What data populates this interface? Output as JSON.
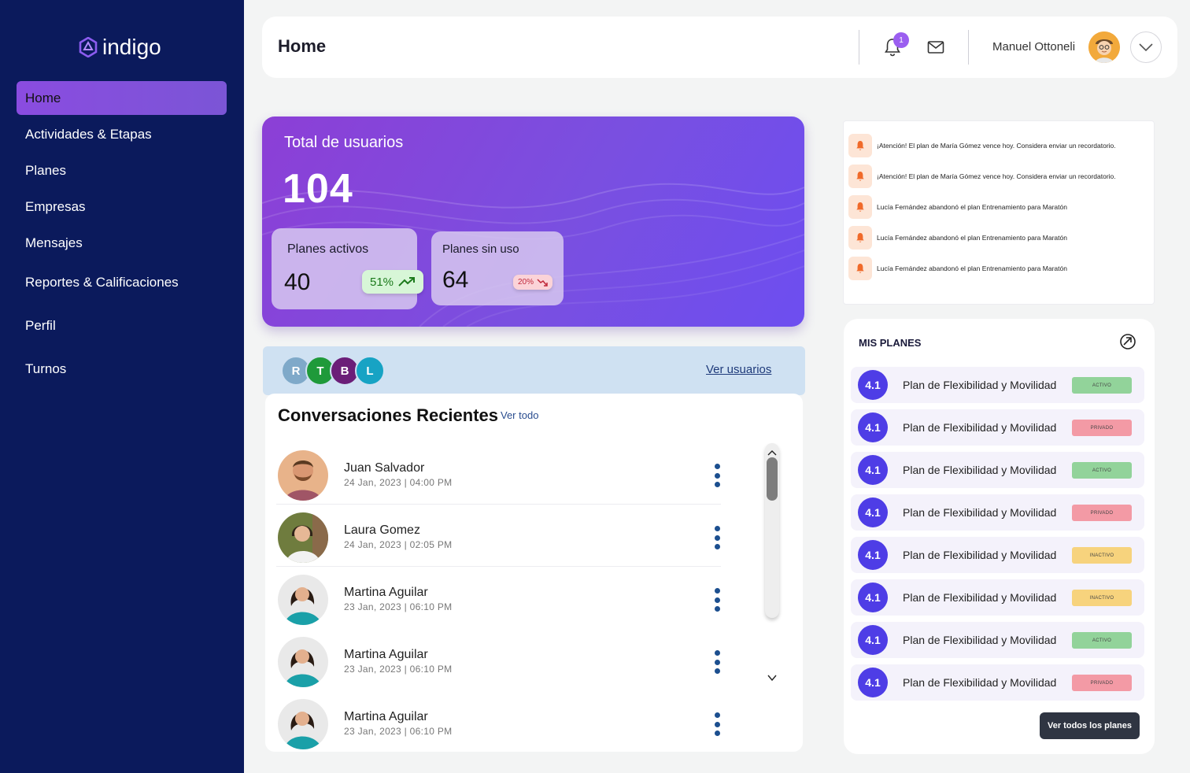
{
  "app": {
    "name": "indigo"
  },
  "sidebar": {
    "items": [
      {
        "label": "Home",
        "active": true
      },
      {
        "label": "Actividades & Etapas"
      },
      {
        "label": "Planes"
      },
      {
        "label": "Empresas"
      },
      {
        "label": "Mensajes"
      },
      {
        "label": "Reportes & Calificaciones"
      },
      {
        "label": "Perfil"
      },
      {
        "label": "Turnos"
      }
    ]
  },
  "header": {
    "title": "Home",
    "notification_count": "1",
    "user_name": "Manuel Ottoneli",
    "icons": [
      "bell-icon",
      "mail-icon",
      "chevron-down-icon"
    ]
  },
  "summary": {
    "label": "Total de usuarios",
    "value": "104",
    "active": {
      "label": "Planes activos",
      "value": "40",
      "change": "51%",
      "trend": "up"
    },
    "unused": {
      "label": "Planes sin uso",
      "value": "64",
      "change": "20%",
      "trend": "down"
    }
  },
  "users_strip": {
    "avatars": [
      {
        "initial": "R",
        "color": "#7fa9c9"
      },
      {
        "initial": "T",
        "color": "#1f9a3a"
      },
      {
        "initial": "B",
        "color": "#6b1e78"
      },
      {
        "initial": "L",
        "color": "#17a3c4"
      }
    ],
    "link": "Ver usuarios"
  },
  "conversations": {
    "title": "Conversaciones Recientes",
    "link": "Ver todo",
    "items": [
      {
        "name": "Juan Salvador",
        "date": "24 Jan, 2023   |   04:00 PM"
      },
      {
        "name": "Laura Gomez",
        "date": "24 Jan, 2023   |   02:05 PM"
      },
      {
        "name": "Martina Aguilar",
        "date": "23 Jan, 2023   |   06:10 PM"
      },
      {
        "name": "Martina Aguilar",
        "date": "23 Jan, 2023   |   06:10 PM"
      },
      {
        "name": "Martina Aguilar",
        "date": "23 Jan, 2023   |   06:10 PM"
      }
    ]
  },
  "notifications": [
    "¡Atención! El plan de María Gómez vence hoy. Considera enviar un recordatorio.",
    "¡Atención! El plan de María Gómez vence hoy. Considera enviar un recordatorio.",
    "Lucía Fernández abandonó el plan Entrenamiento para Maratón",
    "Lucía Fernández abandonó el plan Entrenamiento para Maratón",
    "Lucía Fernández abandonó el plan Entrenamiento para Maratón"
  ],
  "plans": {
    "title": "MIS PLANES",
    "button": "Ver todos los planes",
    "items": [
      {
        "score": "4.1",
        "name": "Plan de Flexibilidad y Movilidad",
        "status": "ACTIVO"
      },
      {
        "score": "4.1",
        "name": "Plan de Flexibilidad y Movilidad",
        "status": "PRIVADO"
      },
      {
        "score": "4.1",
        "name": "Plan de Flexibilidad y Movilidad",
        "status": "ACTIVO"
      },
      {
        "score": "4.1",
        "name": "Plan de Flexibilidad y Movilidad",
        "status": "PRIVADO"
      },
      {
        "score": "4.1",
        "name": "Plan de Flexibilidad y Movilidad",
        "status": "INACTIVO"
      },
      {
        "score": "4.1",
        "name": "Plan de Flexibilidad y Movilidad",
        "status": "INACTIVO"
      },
      {
        "score": "4.1",
        "name": "Plan de Flexibilidad y Movilidad",
        "status": "ACTIVO"
      },
      {
        "score": "4.1",
        "name": "Plan de Flexibilidad y Movilidad",
        "status": "PRIVADO"
      }
    ]
  }
}
